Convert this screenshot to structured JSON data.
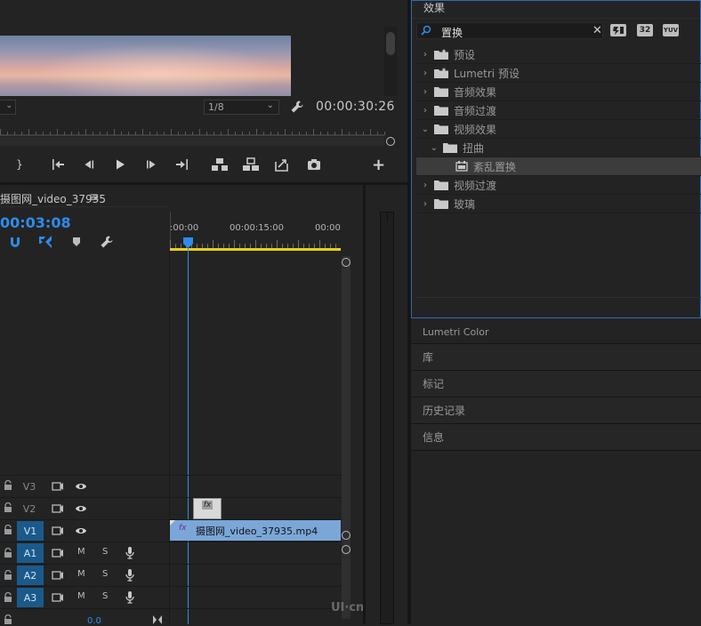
{
  "monitor": {
    "zoom_left": "",
    "resolution": "1/8",
    "timecode": "00:00:30:26",
    "controls": [
      "}",
      "go-to-in",
      "step-back",
      "play",
      "step-forward",
      "go-to-out",
      "lift",
      "extract",
      "export-frame",
      "camera",
      "+"
    ]
  },
  "timeline": {
    "tab_title": "摄图网_video_37935",
    "menu_glyph": "≡",
    "playhead_tc": "00:03:08",
    "ruler": [
      ":00:00",
      "00:00:15:00",
      "00:00"
    ],
    "tracks_video": [
      {
        "label": "V3",
        "active": false
      },
      {
        "label": "V2",
        "active": false
      },
      {
        "label": "V1",
        "active": true
      }
    ],
    "tracks_audio": [
      {
        "label": "A1",
        "m": "M",
        "s": "S"
      },
      {
        "label": "A2",
        "m": "M",
        "s": "S"
      },
      {
        "label": "A3",
        "m": "M",
        "s": "S"
      }
    ],
    "clip_name": "摄图网_video_37935.mp4",
    "clip_fx": "fx",
    "fx_badge": "fx",
    "mix_value": "0.0"
  },
  "effects": {
    "tab_title": "效果",
    "search_value": "置换",
    "badge_32": "32",
    "badge_yuv": "YUV",
    "items": [
      {
        "label": "预设",
        "type": "preset",
        "level": 0,
        "expanded": false
      },
      {
        "label": "Lumetri 预设",
        "type": "preset",
        "level": 0,
        "expanded": false
      },
      {
        "label": "音频效果",
        "type": "folder",
        "level": 0,
        "expanded": false
      },
      {
        "label": "音频过渡",
        "type": "folder",
        "level": 0,
        "expanded": false
      },
      {
        "label": "视频效果",
        "type": "folder",
        "level": 0,
        "expanded": true
      },
      {
        "label": "扭曲",
        "type": "folder",
        "level": 1,
        "expanded": true
      },
      {
        "label": "紊乱置换",
        "type": "effect",
        "level": 2,
        "selected": true
      },
      {
        "label": "视频过渡",
        "type": "folder",
        "level": 0,
        "expanded": false
      },
      {
        "label": "玻璃",
        "type": "folder",
        "level": 0,
        "expanded": false
      }
    ]
  },
  "stack": [
    "Lumetri Color",
    "库",
    "标记",
    "历史记录",
    "信息"
  ],
  "watermark": "UI·cn",
  "colors": {
    "accent": "#2d8ceb",
    "clip": "#7aa7d8",
    "yellow_bar": "#e6d219",
    "panel_border": "#2f6bb5"
  }
}
